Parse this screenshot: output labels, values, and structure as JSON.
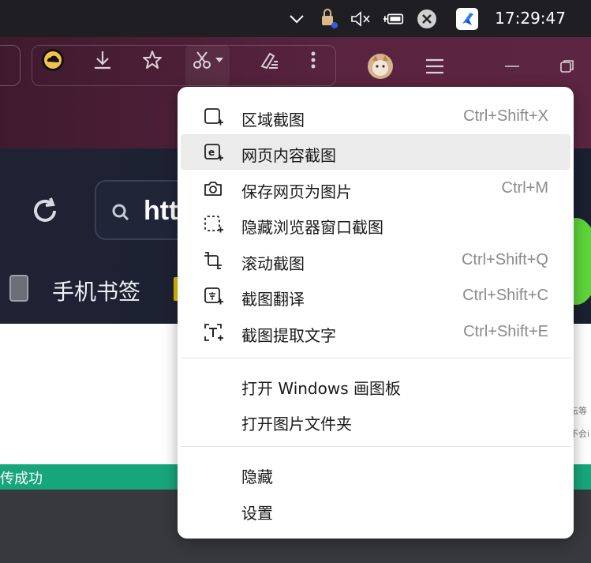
{
  "taskbar": {
    "clock": "17:29:47",
    "icons": [
      "chevron-up-icon",
      "network-lock-icon",
      "volume-muted-icon",
      "battery-charging-icon",
      "close-circle-icon",
      "app-k-icon"
    ]
  },
  "toolbar": {
    "buttons": [
      "cloud-icon",
      "download-icon",
      "star-icon",
      "scissors-icon",
      "chevron-down-icon",
      "clear-data-icon",
      "more-vertical-icon"
    ],
    "window_buttons": [
      "avatar",
      "menu-icon",
      "minimize-icon",
      "restore-icon"
    ]
  },
  "page": {
    "search_text": "htt",
    "bookmark_label": "手机书签",
    "side_text_1": "坛等",
    "side_text_2": "不会i",
    "green_bar_text": "传成功"
  },
  "menu": {
    "items": [
      {
        "label": "区域截图",
        "shortcut": "Ctrl+Shift+X",
        "icon": "area-screenshot-icon"
      },
      {
        "label": "网页内容截图",
        "shortcut": "",
        "icon": "webpage-screenshot-icon",
        "highlighted": true
      },
      {
        "label": "保存网页为图片",
        "shortcut": "Ctrl+M",
        "icon": "camera-icon"
      },
      {
        "label": "隐藏浏览器窗口截图",
        "shortcut": "",
        "icon": "hidden-window-screenshot-icon"
      },
      {
        "label": "滚动截图",
        "shortcut": "Ctrl+Shift+Q",
        "icon": "scroll-screenshot-icon"
      },
      {
        "label": "截图翻译",
        "shortcut": "Ctrl+Shift+C",
        "icon": "translate-screenshot-icon"
      },
      {
        "label": "截图提取文字",
        "shortcut": "Ctrl+Shift+E",
        "icon": "extract-text-icon"
      },
      {
        "label": "打开 Windows 画图板",
        "shortcut": ""
      },
      {
        "label": "打开图片文件夹",
        "shortcut": ""
      },
      {
        "label": "隐藏",
        "shortcut": ""
      },
      {
        "label": "设置",
        "shortcut": ""
      }
    ]
  }
}
